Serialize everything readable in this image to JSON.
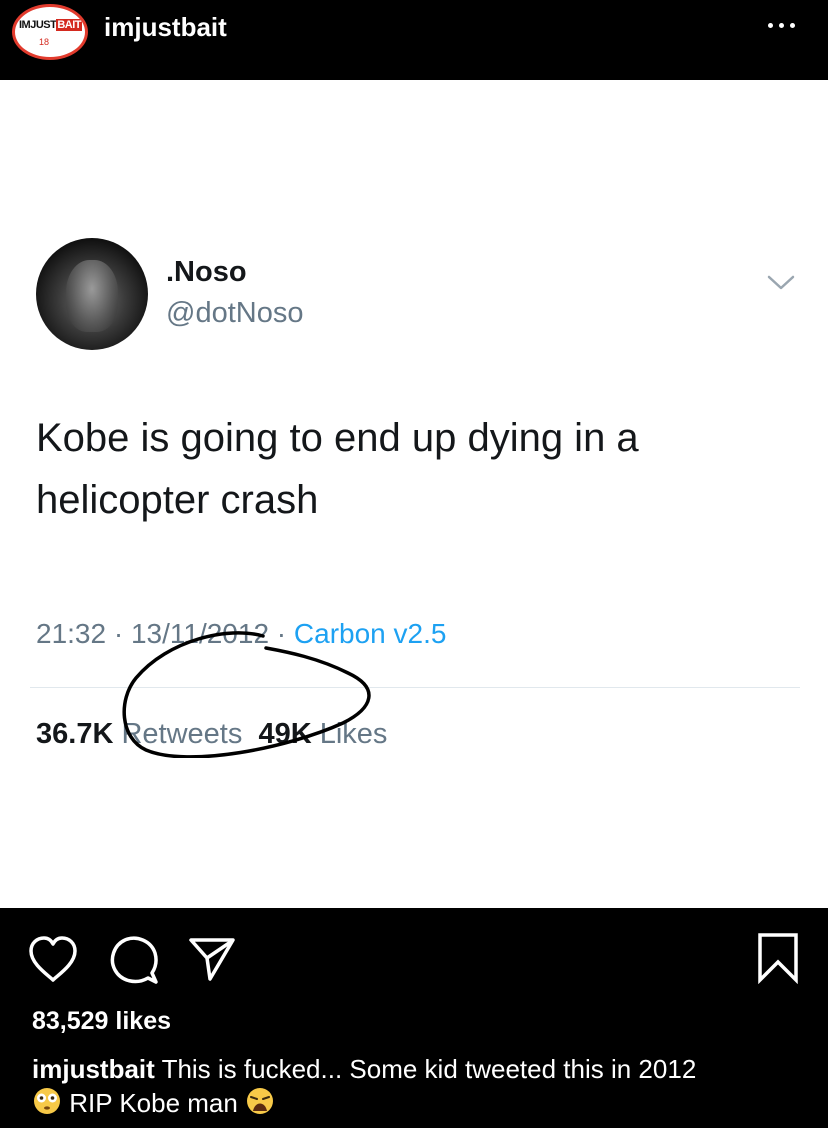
{
  "header": {
    "username": "imjustbait",
    "logo_text_main": "IMJUST",
    "logo_text_accent": "BAIT",
    "logo_sub": "18",
    "more_icon": "more-horizontal-icon"
  },
  "tweet": {
    "display_name": ".Noso",
    "handle": "@dotNoso",
    "text": "Kobe is going to end up dying in a helicopter crash",
    "time": "21:32",
    "date": "13/11/2012",
    "source": "Carbon v2.5",
    "retweets_count": "36.7K",
    "retweets_label": "Retweets",
    "likes_count": "49K",
    "likes_label": "Likes"
  },
  "post": {
    "likes": "83,529 likes",
    "caption_user": "imjustbait",
    "caption_text": "This is fucked... Some kid tweeted this in 2012",
    "caption_text2": "RIP Kobe man",
    "icons": [
      "heart-icon",
      "comment-icon",
      "share-icon",
      "bookmark-icon"
    ]
  },
  "colors": {
    "background": "#000000",
    "tweet_bg": "#ffffff",
    "tweet_text": "#14171a",
    "tweet_secondary": "#657786",
    "link": "#1da1f2",
    "brand_red": "#e23b2d"
  }
}
